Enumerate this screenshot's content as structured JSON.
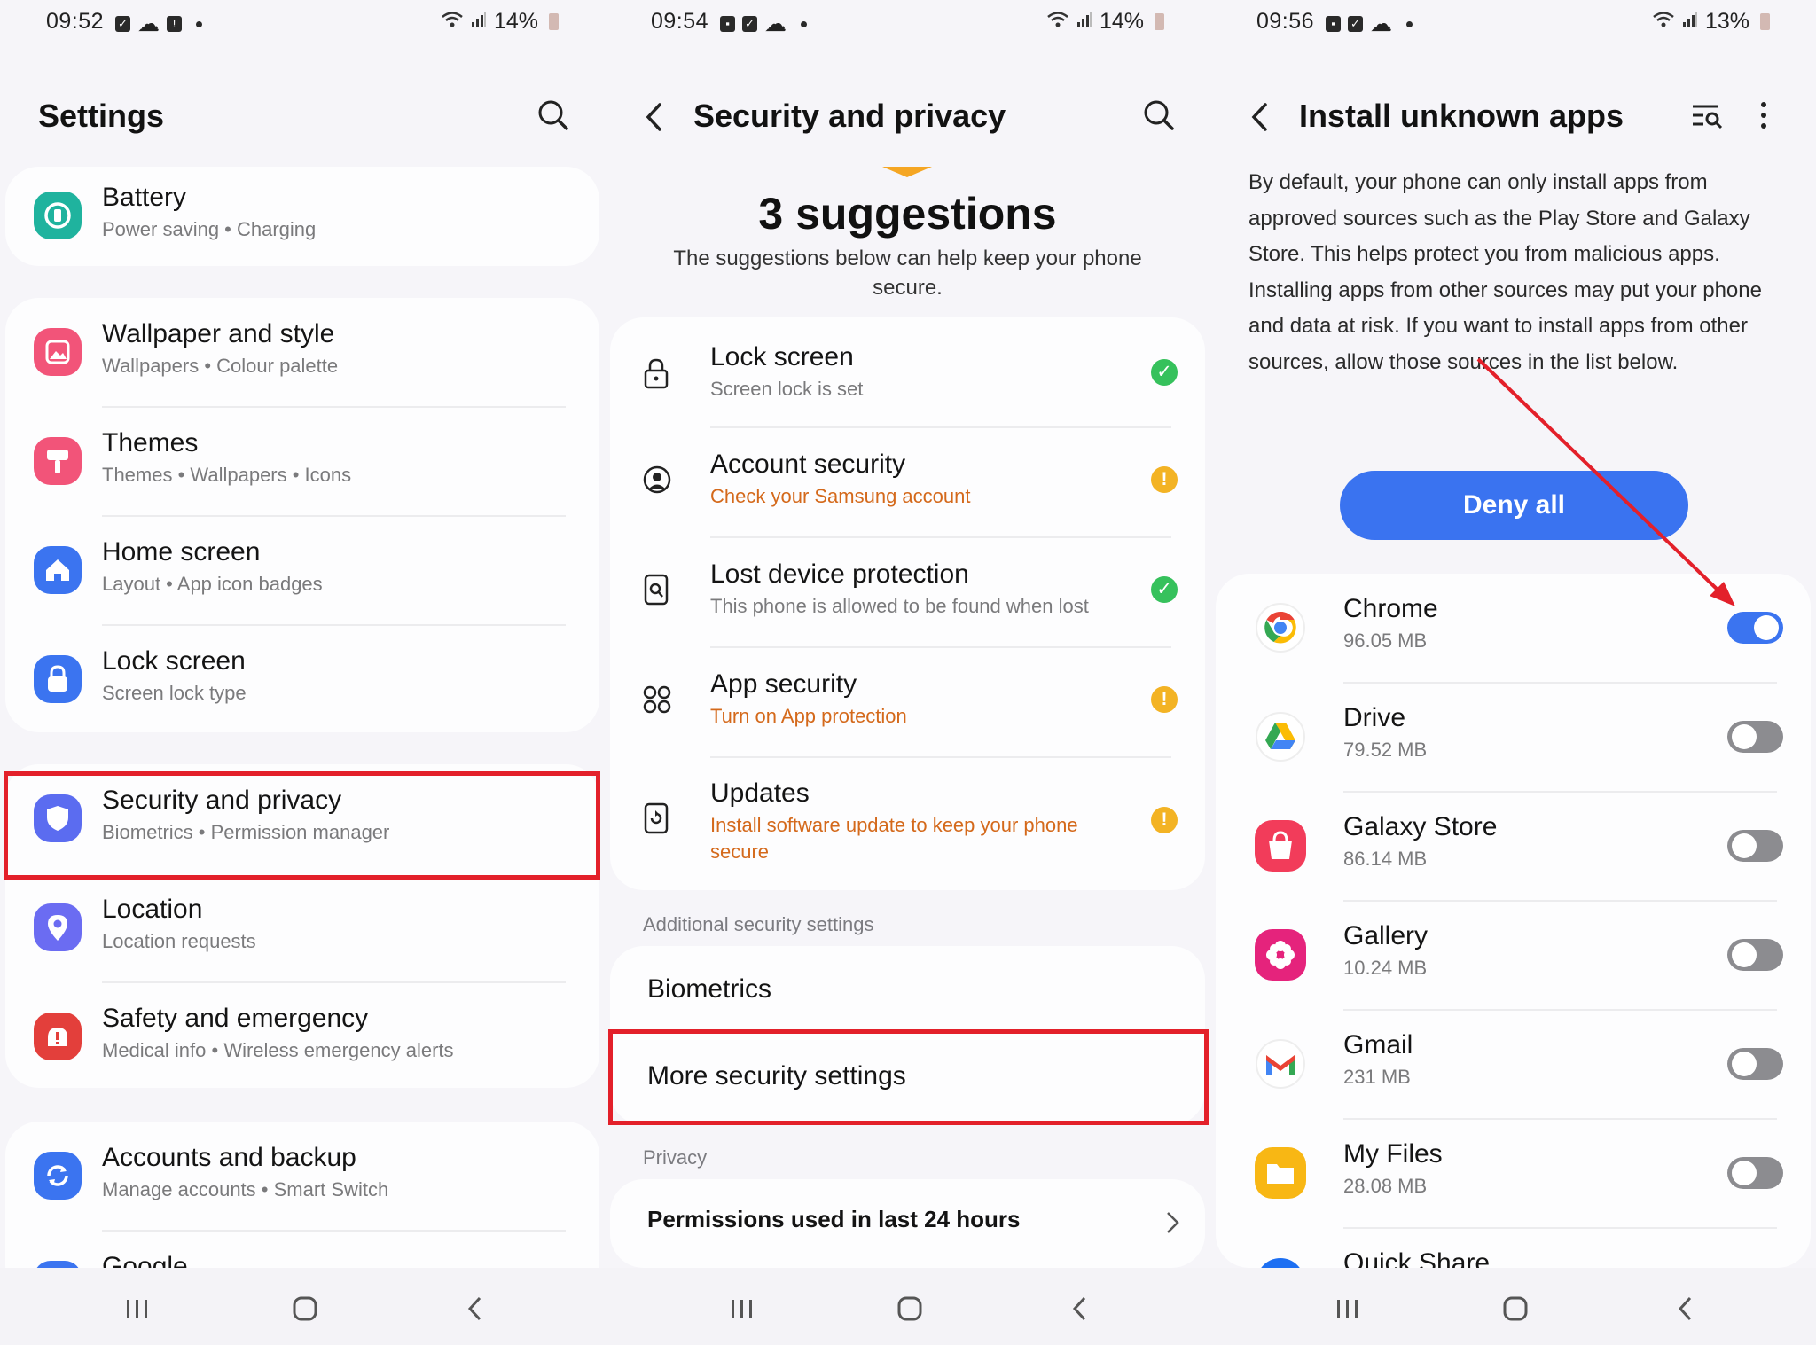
{
  "colors": {
    "accent": "#3b74f0",
    "highlight": "#e3202a",
    "ok": "#36c15c",
    "warn": "#f3b324",
    "warn_text": "#d4691b",
    "arrow": "#e3202a"
  },
  "panel1": {
    "status": {
      "time": "09:52",
      "battery": "14%"
    },
    "title": "Settings",
    "items": [
      {
        "label": "Battery",
        "sub": "Power saving  •  Charging",
        "icon": "battery-icon"
      },
      {
        "label": "Wallpaper and style",
        "sub": "Wallpapers  •  Colour palette",
        "icon": "wallpaper-icon"
      },
      {
        "label": "Themes",
        "sub": "Themes  •  Wallpapers  •  Icons",
        "icon": "themes-icon"
      },
      {
        "label": "Home screen",
        "sub": "Layout  •  App icon badges",
        "icon": "home-icon"
      },
      {
        "label": "Lock screen",
        "sub": "Screen lock type",
        "icon": "lock-icon"
      },
      {
        "label": "Security and privacy",
        "sub": "Biometrics  •  Permission manager",
        "icon": "shield-icon"
      },
      {
        "label": "Location",
        "sub": "Location requests",
        "icon": "location-icon"
      },
      {
        "label": "Safety and emergency",
        "sub": "Medical info  •  Wireless emergency alerts",
        "icon": "emergency-icon"
      },
      {
        "label": "Accounts and backup",
        "sub": "Manage accounts  •  Smart Switch",
        "icon": "sync-icon"
      },
      {
        "label": "Google",
        "sub": "",
        "icon": "google-icon"
      }
    ]
  },
  "panel2": {
    "status": {
      "time": "09:54",
      "battery": "14%"
    },
    "title": "Security and privacy",
    "suggestions_title": "3 suggestions",
    "suggestions_sub": "The suggestions below can help keep your phone secure.",
    "items": [
      {
        "label": "Lock screen",
        "sub": "Screen lock is set",
        "status": "ok",
        "icon": "lock-icon"
      },
      {
        "label": "Account security",
        "sub": "Check your Samsung account",
        "status": "warn",
        "icon": "account-icon"
      },
      {
        "label": "Lost device protection",
        "sub": "This phone is allowed to be found when lost",
        "status": "ok",
        "icon": "find-device-icon"
      },
      {
        "label": "App security",
        "sub": "Turn on App protection",
        "status": "warn",
        "icon": "apps-grid-icon"
      },
      {
        "label": "Updates",
        "sub": "Install software update to keep your phone secure",
        "status": "warn",
        "icon": "update-icon"
      }
    ],
    "additional_label": "Additional security settings",
    "biometrics": "Biometrics",
    "more_security": "More security settings",
    "privacy_label": "Privacy",
    "permissions": "Permissions used in last 24 hours"
  },
  "panel3": {
    "status": {
      "time": "09:56",
      "battery": "13%"
    },
    "title": "Install unknown apps",
    "description": "By default, your phone can only install apps from approved sources such as the Play Store and Galaxy Store. This helps protect you from malicious apps. Installing apps from other sources may put your phone and data at risk. If you want to install apps from other sources, allow those sources in the list below.",
    "deny_all": "Deny all",
    "apps": [
      {
        "name": "Chrome",
        "size": "96.05 MB",
        "enabled": true,
        "icon": "chrome-icon"
      },
      {
        "name": "Drive",
        "size": "79.52 MB",
        "enabled": false,
        "icon": "drive-icon"
      },
      {
        "name": "Galaxy Store",
        "size": "86.14 MB",
        "enabled": false,
        "icon": "galaxy-store-icon"
      },
      {
        "name": "Gallery",
        "size": "10.24 MB",
        "enabled": false,
        "icon": "gallery-icon"
      },
      {
        "name": "Gmail",
        "size": "231 MB",
        "enabled": false,
        "icon": "gmail-icon"
      },
      {
        "name": "My Files",
        "size": "28.08 MB",
        "enabled": false,
        "icon": "folder-icon"
      },
      {
        "name": "Quick Share",
        "size": "",
        "enabled": false,
        "icon": "quick-share-icon"
      }
    ]
  }
}
